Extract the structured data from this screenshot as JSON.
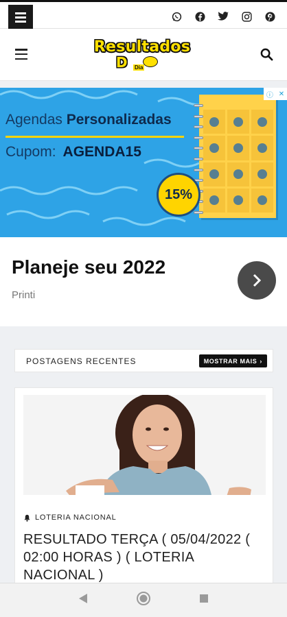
{
  "topbar": {
    "social_icons": [
      "whatsapp-icon",
      "facebook-icon",
      "twitter-icon",
      "instagram-icon",
      "pinterest-icon"
    ]
  },
  "header": {
    "logo_title": "Resultados",
    "logo_d": "D",
    "logo_dia": "Dia"
  },
  "ad": {
    "line1_normal": "Agendas",
    "line1_bold": "Personalizadas",
    "line2_normal": "Cupom:",
    "line2_bold": "AGENDA15",
    "badge": "15%",
    "headline": "Planeje seu 2022",
    "advertiser": "Printi",
    "colors": {
      "background": "#2ea3e6",
      "accent": "#ffd400"
    }
  },
  "recent": {
    "title": "POSTAGENS RECENTES",
    "more_button": "MOSTRAR MAIS"
  },
  "post": {
    "category": "LOTERIA NACIONAL",
    "title": "RESULTADO TERÇA ( 05/04/2022 ( 02:00 HORAS ) ( LOTERIA NACIONAL )"
  },
  "navbar": {
    "buttons": [
      "back-icon",
      "home-icon",
      "recents-icon"
    ]
  }
}
